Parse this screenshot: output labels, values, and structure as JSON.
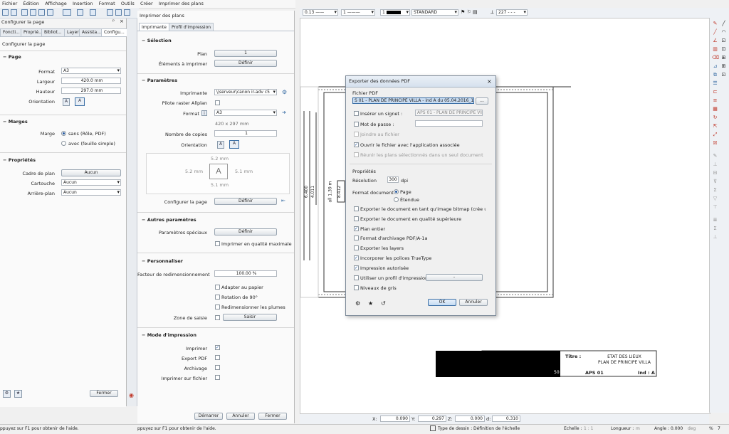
{
  "menu": [
    "Fichier",
    "Édition",
    "Affichage",
    "Insertion",
    "Format",
    "Outils",
    "Créer",
    "Imprimer des plans"
  ],
  "left_panel": {
    "title": "Configurer la page",
    "tabs": [
      "Foncti...",
      "Proprié...",
      "Bibliot...",
      "Layer",
      "Assista...",
      "Configu..."
    ],
    "subtitle": "Configurer la page",
    "page_section": "Page",
    "format_label": "Format",
    "format_value": "A3",
    "largeur_label": "Largeur",
    "largeur_value": "420.0 mm",
    "hauteur_label": "Hauteur",
    "hauteur_value": "297.0 mm",
    "orientation_label": "Orientation",
    "marges_section": "Marges",
    "marge_label": "Marge",
    "marge_opt1": "sans (Rôle, PDF)",
    "marge_opt2": "avec (feuille simple)",
    "props_section": "Propriétés",
    "cadre_label": "Cadre de plan",
    "cadre_value": "Aucun",
    "cartouche_label": "Cartouche",
    "cartouche_value": "Aucun",
    "arriere_label": "Arrière-plan",
    "arriere_value": "Aucun",
    "fermer": "Fermer"
  },
  "print_panel": {
    "title": "Imprimer des plans",
    "tabs": [
      "Imprimante",
      "Profil d'impression"
    ],
    "selection_section": "Sélection",
    "plan_label": "Plan",
    "plan_value": "1",
    "elements_label": "Éléments à imprimer",
    "definir": "Définir",
    "params_section": "Paramètres",
    "imprimante_label": "Imprimante",
    "imprimante_value": "\\\\serveur\\canon ir-adv c5",
    "pilote_label": "Pilote raster Allplan",
    "format_label": "Format",
    "format_value": "A3",
    "format_dims": "420 x 297 mm",
    "copies_label": "Nombre de copies",
    "copies_value": "1",
    "orientation_label": "Orientation",
    "margin_top": "5.2 mm",
    "margin_left": "5.2 mm",
    "margin_right": "5.1 mm",
    "margin_bottom": "5.1 mm",
    "configurer_label": "Configurer la page",
    "autres_section": "Autres paramètres",
    "speciaux_label": "Paramètres spéciaux",
    "qualite_label": "Imprimer en qualité maximale",
    "perso_section": "Personnaliser",
    "facteur_label": "Facteur de redimensionnement",
    "facteur_value": "100.00 %",
    "adapter_label": "Adapter au papier",
    "rotation_label": "Rotation de 90°",
    "plumes_label": "Redimensionner les plumes",
    "zone_label": "Zone de saisie",
    "saisir": "Saisir",
    "mode_section": "Mode d'impression",
    "imprimer_label": "Imprimer",
    "export_label": "Export PDF",
    "archivage_label": "Archivage",
    "fichier_label": "Imprimer sur fichier",
    "demarrer": "Démarrer",
    "annuler": "Annuler",
    "fermer": "Fermer"
  },
  "top_toolbar": {
    "pen": "0.13",
    "line": "1",
    "color": "1",
    "layer": "STANDARD",
    "scale": "227"
  },
  "dialog": {
    "title": "Exporter des données PDF",
    "fichier_label": "Fichier PDF",
    "fichier_value": "S 01 - PLAN DE PRINCIPE VILLA - ind A du 05.04.2016_1.pdf",
    "browse": "...",
    "signet_label": "Insérer un signet :",
    "signet_value": "APS 01 - PLAN DE PRINCIPE VILLA",
    "passe_label": "Mot de passe :",
    "joindre_label": "Joindre au fichier",
    "ouvrir_label": "Ouvrir le fichier avec l'application associée",
    "reunir_label": "Réunir les plans sélectionnés dans un seul document",
    "props_label": "Propriétés",
    "resolution_label": "Résolution",
    "resolution_value": "300",
    "dpi": "dpi",
    "format_doc_label": "Format document",
    "page_opt": "Page",
    "etendue_opt": "Étendue",
    "opt1": "Exporter le document en tant qu'image bitmap (crée un volume de de",
    "opt2": "Exporter le document en qualité supérieure",
    "opt3": "Plan entier",
    "opt4": "Format d'archivage PDF/A-1a",
    "opt5": "Exporter les layers",
    "opt6": "Incorporer les polices TrueType",
    "opt7": "Impression autorisée",
    "opt8": "Utiliser un profil d'impression",
    "opt8_btn": "-",
    "opt9": "Niveaux de gris",
    "ok": "OK",
    "cancel": "Annuler"
  },
  "drawing": {
    "dim1": "6.400",
    "dim2": "4.011",
    "dim3": "all 1.39 m",
    "dim4": "8.412",
    "titre_label": "Titre :",
    "titre1": "ETAT DES LIEUX",
    "titre2": "PLAN DE PRINCIPE VILLA",
    "code": "APS 01",
    "ind": "Ind : A",
    "num": "50"
  },
  "coords": {
    "x_label": "X:",
    "x": "0.090",
    "y_label": "Y:",
    "y": "0.297",
    "z_label": "Z:",
    "z": "0.000",
    "d_label": "d:",
    "d": "0.310"
  },
  "status": {
    "help_left": "ppuyez sur F1 pour obtenir de l'aide.",
    "help_mid": "ppuyez sur F1 pour obtenir de l'aide.",
    "type_label": "Type de dessin :",
    "type_value": "Définition de l'échelle",
    "echelle_label": "Echelle :",
    "echelle_value": "1 : 1",
    "longueur_label": "Longueur :",
    "longueur_value": "m",
    "angle_label": "Angle :",
    "angle_value": "0.000",
    "deg": "deg",
    "pct_label": "%",
    "pct_value": "7"
  }
}
